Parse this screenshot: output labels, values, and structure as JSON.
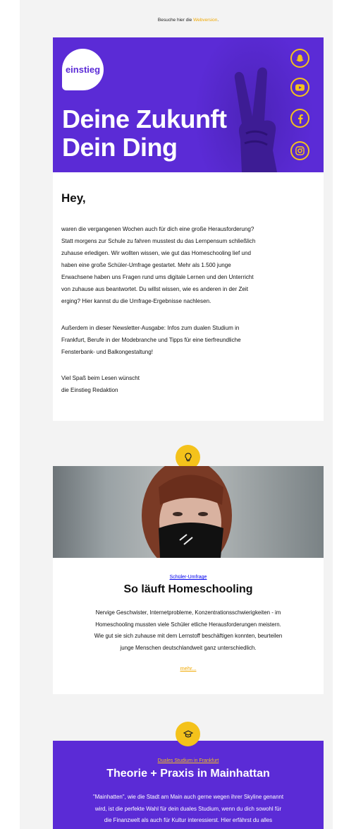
{
  "header": {
    "webversion_prefix": "Besuche hier die ",
    "webversion_link": "Webversion",
    "webversion_suffix": "."
  },
  "hero": {
    "logo_text": "einstieg",
    "title_line1": "Deine Zukunft",
    "title_line2": "Dein Ding",
    "social_icons": [
      "snapchat-icon",
      "youtube-icon",
      "facebook-icon",
      "instagram-icon"
    ],
    "accent_color": "#f4c21b",
    "brand_color": "#5b2bd6"
  },
  "intro": {
    "greeting": "Hey,",
    "paragraph1": [
      "waren die vergangenen Wochen auch für dich eine große Herausforderung?",
      "Statt morgens zur Schule zu fahren musstest du das Lernpensum schließlich",
      "zuhause erledigen. Wir wollten wissen, wie gut das Homeschooling lief und",
      "haben eine große Schüler-Umfrage gestartet. Mehr als 1.500 junge",
      "Erwachsene haben uns Fragen rund ums digitale Lernen und den Unterricht",
      "von zuhause aus beantwortet. Du willst wissen, wie es anderen in der Zeit",
      "erging? Hier kannst du die Umfrage-Ergebnisse nachlesen."
    ],
    "paragraph2": [
      "Außerdem in dieser Newsletter-Ausgabe: Infos zum dualen Studium in",
      "Frankfurt, Berufe in der Modebranche und Tipps für eine tierfreundliche",
      "Fensterbank- und Balkongestaltung!"
    ],
    "signoff": [
      "Viel Spaß beim Lesen wünscht",
      "die Einstieg Redaktion"
    ]
  },
  "article1": {
    "badge_icon": "lightbulb-icon",
    "kicker": "Schüler-Umfrage",
    "title": "So läuft Homeschooling",
    "body": [
      "Nervige Geschwister, Internetprobleme, Konzentrationsschwierigkeiten - im",
      "Homeschooling mussten viele Schüler etliche Herausforderungen meistern.",
      "Wie gut sie sich zuhause mit dem Lernstoff beschäftigen konnten, beurteilen",
      "junge Menschen deutschlandweit ganz unterschiedlich."
    ],
    "more": "mehr..."
  },
  "article2": {
    "badge_icon": "graduation-cap-icon",
    "kicker": "Duales Studium in Frankfurt",
    "title": "Theorie + Praxis in Mainhattan",
    "body": [
      "\"Mainhatten\", wie die Stadt am Main auch gerne wegen ihrer Skyline genannt",
      "wird, ist die perfekte Wahl für dein duales Studium, wenn du dich sowohl für",
      "die Finanzwelt als auch für Kultur interessierst. Hier erfährst du alles"
    ]
  }
}
